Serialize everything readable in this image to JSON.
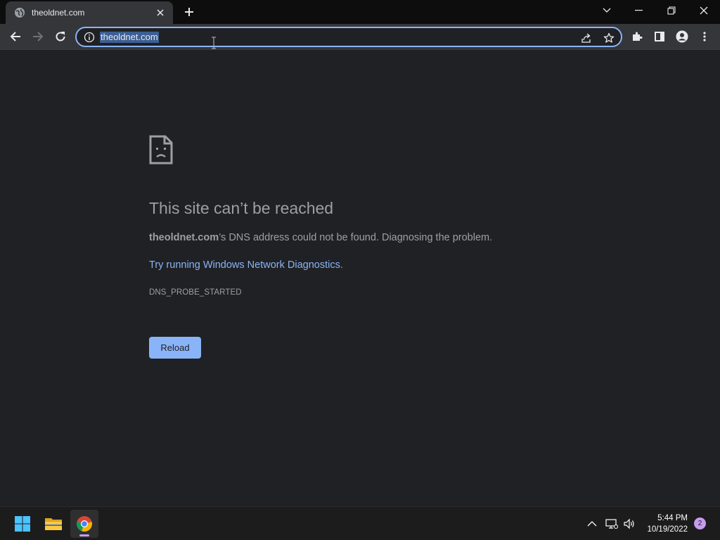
{
  "browser": {
    "tab": {
      "title": "theoldnet.com",
      "favicon": "globe-icon"
    },
    "address_bar": {
      "url": "theoldnet.com",
      "selected": true
    }
  },
  "error_page": {
    "title": "This site can’t be reached",
    "host": "theoldnet.com",
    "description_rest": "’s DNS address could not be found. Diagnosing the problem.",
    "suggestion_link": "Try running Windows Network Diagnostics",
    "suggestion_period": ".",
    "error_code": "DNS_PROBE_STARTED",
    "reload_label": "Reload"
  },
  "taskbar": {
    "apps": [
      "windows-start",
      "file-explorer",
      "google-chrome"
    ],
    "clock": {
      "time": "5:44 PM",
      "date": "10/19/2022"
    },
    "notification_count": "2"
  },
  "colors": {
    "page_background": "#202124",
    "link": "#8ab4f8",
    "button": "#8ab4f8",
    "text": "#9aa0a6"
  }
}
